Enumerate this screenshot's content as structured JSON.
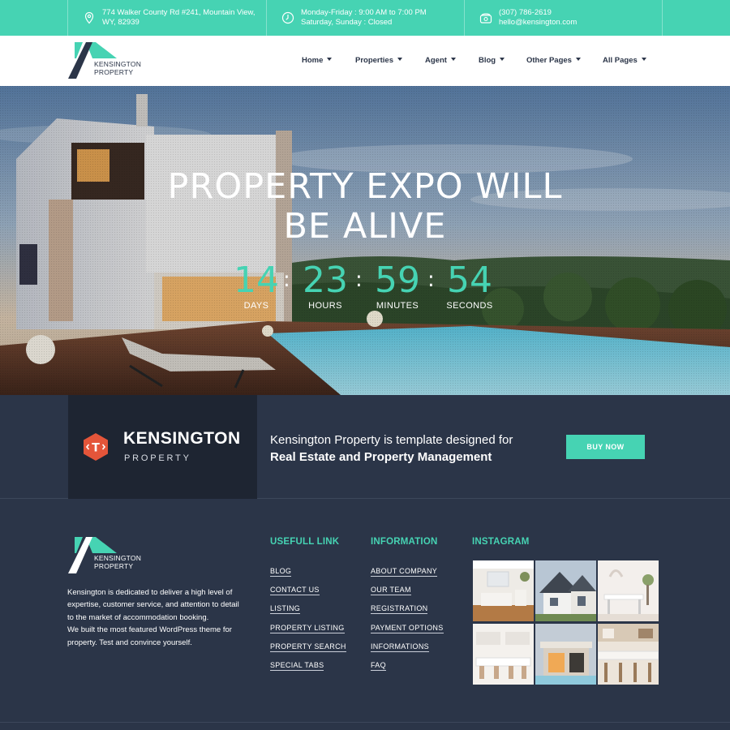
{
  "topbar": {
    "address_line1": "774 Walker County Rd #241, Mountain View,",
    "address_line2": "WY, 82939",
    "hours_line1": "Monday-Friday : 9:00 AM to 7:00 PM",
    "hours_line2": "Saturday, Sunday : Closed",
    "phone": "(307) 786-2619",
    "email": "hello@kensington.com"
  },
  "logo": {
    "line1": "KENSINGTON",
    "line2": "PROPERTY"
  },
  "nav": {
    "items": [
      {
        "label": "Home"
      },
      {
        "label": "Properties"
      },
      {
        "label": "Agent"
      },
      {
        "label": "Blog"
      },
      {
        "label": "Other Pages"
      },
      {
        "label": "All Pages"
      }
    ]
  },
  "hero": {
    "title_line1": "PROPERTY EXPO WILL",
    "title_line2": "BE ALIVE",
    "countdown": [
      {
        "value": "14",
        "label": "DAYS"
      },
      {
        "value": "23",
        "label": "HOURS"
      },
      {
        "value": "59",
        "label": "MINUTES"
      },
      {
        "value": "54",
        "label": "SECONDS"
      }
    ],
    "separator": ":"
  },
  "promo": {
    "brand_name": "KENSINGTON",
    "brand_sub": "PROPERTY",
    "text_line1": "Kensington Property is template designed for",
    "text_line2": "Real Estate and Property Management",
    "button_label": "BUY NOW"
  },
  "footer": {
    "logo": {
      "line1": "KENSINGTON",
      "line2": "PROPERTY"
    },
    "about_lines": [
      "Kensington is dedicated to deliver a high level of",
      "expertise, customer service, and attention to detail",
      "to the market of accommodation booking.",
      "We built the most featured WordPress theme for",
      "property. Test and convince yourself."
    ],
    "useful_title": "USEFULL LINK",
    "useful_links": [
      "BLOG",
      "CONTACT US",
      "LISTING",
      "PROPERTY LISTING",
      "PROPERTY SEARCH",
      "SPECIAL TABS"
    ],
    "info_title": "INFORMATION",
    "info_links": [
      "ABOUT COMPANY",
      "OUR TEAM",
      "REGISTRATION",
      "PAYMENT OPTIONS",
      "INFORMATIONS",
      "FAQ"
    ],
    "instagram_title": "INSTAGRAM"
  },
  "colors": {
    "accent": "#46d3b3",
    "dark": "#2b3548",
    "darker": "#1e2532",
    "brand_icon": "#e4553a"
  }
}
